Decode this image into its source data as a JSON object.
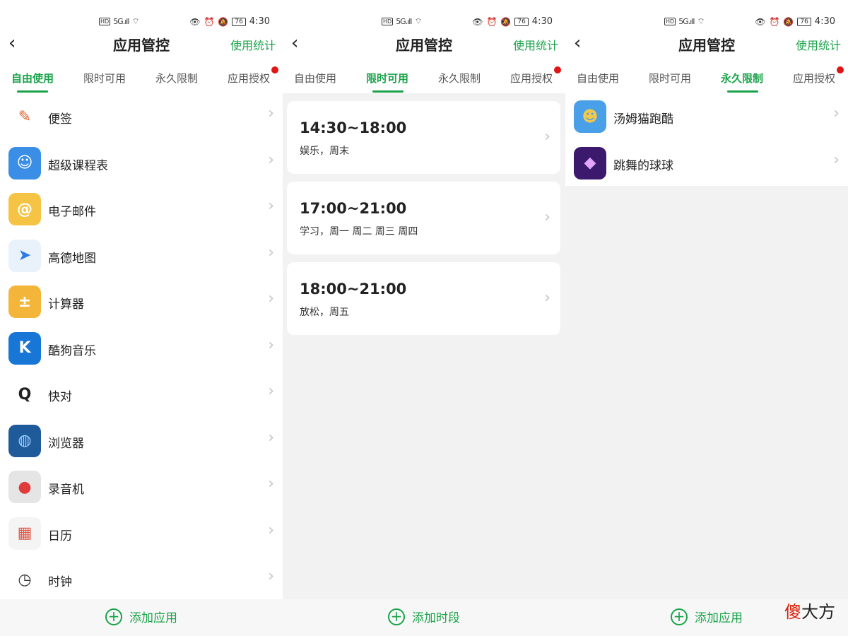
{
  "status": {
    "hd": "HD",
    "signal": "5G.ıll",
    "wifi": "⌔",
    "battery": "76",
    "time": "4:30"
  },
  "header": {
    "back": "‹",
    "title": "应用管控",
    "stats": "使用统计"
  },
  "tabs": [
    "自由使用",
    "限时可用",
    "永久限制",
    "应用授权"
  ],
  "panel1": {
    "apps": [
      {
        "name": "便签",
        "icon": "✎",
        "bg": "#ffffff",
        "fg": "#e06030"
      },
      {
        "name": "超级课程表",
        "icon": "☺",
        "bg": "#3a8ee6",
        "fg": "#ffffff"
      },
      {
        "name": "电子邮件",
        "icon": "@",
        "bg": "#f6c445",
        "fg": "#ffffff"
      },
      {
        "name": "高德地图",
        "icon": "➤",
        "bg": "#e9f2fb",
        "fg": "#2c7be5"
      },
      {
        "name": "计算器",
        "icon": "±",
        "bg": "#f4b63a",
        "fg": "#ffffff"
      },
      {
        "name": "酷狗音乐",
        "icon": "K",
        "bg": "#1776d6",
        "fg": "#ffffff"
      },
      {
        "name": "快对",
        "icon": "Q",
        "bg": "#ffffff",
        "fg": "#222222"
      },
      {
        "name": "浏览器",
        "icon": "◍",
        "bg": "#1f5b9a",
        "fg": "#9fd0ff"
      },
      {
        "name": "录音机",
        "icon": "●",
        "bg": "#e5e5e5",
        "fg": "#e03a3a"
      },
      {
        "name": "日历",
        "icon": "▦",
        "bg": "#f4f4f4",
        "fg": "#e05a4a"
      },
      {
        "name": "时钟",
        "icon": "◷",
        "bg": "#ffffff",
        "fg": "#333333"
      }
    ],
    "add_label": "添加应用"
  },
  "panel2": {
    "slots": [
      {
        "time": "14:30~18:00",
        "desc": "娱乐，周末"
      },
      {
        "time": "17:00~21:00",
        "desc": "学习，周一 周二 周三 周四"
      },
      {
        "time": "18:00~21:00",
        "desc": "放松，周五"
      }
    ],
    "add_label": "添加时段"
  },
  "panel3": {
    "apps": [
      {
        "name": "汤姆猫跑酷",
        "icon": "☻",
        "bg": "#4aa0e8",
        "fg": "#f2c94c"
      },
      {
        "name": "跳舞的球球",
        "icon": "◆",
        "bg": "#3b1a6e",
        "fg": "#e3a6ff"
      }
    ],
    "add_label": "添加应用"
  },
  "chevron": "›",
  "plus": "+",
  "watermark": {
    "red": "傻",
    "rest": "大方"
  },
  "colors": {
    "accent": "#1aa34a",
    "badge": "#e01515"
  }
}
